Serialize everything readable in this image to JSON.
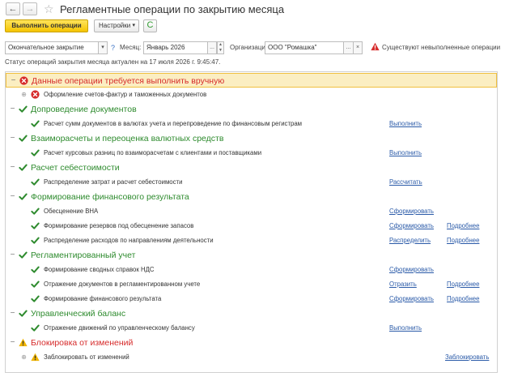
{
  "window": {
    "title": "Регламентные операции по закрытию месяца",
    "back_glyph": "←",
    "forward_glyph": "→",
    "favorite_glyph": "☆"
  },
  "toolbar": {
    "run_label": "Выполнить операции",
    "settings_label": "Настройки",
    "settings_caret": "▾",
    "refresh_glyph": "C"
  },
  "filters": {
    "closing_type": "Окончательное закрытие",
    "dropdown_glyph": "▾",
    "help_glyph": "?",
    "month_label": "Месяц:",
    "month_value": "Январь 2026",
    "picker_glyph": "...",
    "org_label": "Организации:",
    "org_value": "ООО \"Ромашка\"",
    "clear_glyph": "×",
    "warning_text": "Существуют невыполненные операции"
  },
  "status_text": "Статус операций закрытия месяца актуален на 17 июля 2026 г. 9:45:47.",
  "colors": {
    "success": "#2e8b2e",
    "error": "#d62b2b",
    "warning": "#f0b400",
    "link": "#2a5aa8",
    "highlight": "#fbeec2"
  },
  "groups": [
    {
      "title": "Данные операции требуется выполнить вручную",
      "status": "error",
      "items": [
        {
          "title": "Оформление счетов-фактур и таможенных документов",
          "status": "error",
          "expandable": true
        }
      ]
    },
    {
      "title": "Допроведение документов",
      "status": "ok",
      "items": [
        {
          "title": "Расчет сумм документов в валютах учета и перепроведение по финансовым регистрам",
          "status": "ok",
          "action": "Выполнить"
        }
      ]
    },
    {
      "title": "Взаиморасчеты и переоценка валютных средств",
      "status": "ok",
      "items": [
        {
          "title": "Расчет курсовых разниц по взаиморасчетам с клиентами и поставщиками",
          "status": "ok",
          "action": "Выполнить"
        }
      ]
    },
    {
      "title": "Расчет себестоимости",
      "status": "ok",
      "items": [
        {
          "title": "Распределение затрат и расчет себестоимости",
          "status": "ok",
          "action": "Рассчитать"
        }
      ]
    },
    {
      "title": "Формирование финансового результата",
      "status": "ok",
      "items": [
        {
          "title": "Обесценение ВНА",
          "status": "ok",
          "action": "Сформировать"
        },
        {
          "title": "Формирование резервов под обесценение запасов",
          "status": "ok",
          "action": "Сформировать",
          "details": "Подробнее"
        },
        {
          "title": "Распределение расходов по направлениям деятельности",
          "status": "ok",
          "action": "Распределить",
          "details": "Подробнее"
        }
      ]
    },
    {
      "title": "Регламентированный учет",
      "status": "ok",
      "items": [
        {
          "title": "Формирование сводных справок НДС",
          "status": "ok",
          "action": "Сформировать"
        },
        {
          "title": "Отражение документов в регламентированном учете",
          "status": "ok",
          "action": "Отразить",
          "details": "Подробнее"
        },
        {
          "title": "Формирование финансового результата",
          "status": "ok",
          "action": "Сформировать",
          "details": "Подробнее"
        }
      ]
    },
    {
      "title": "Управленческий баланс",
      "status": "ok",
      "items": [
        {
          "title": "Отражение движений по управленческому балансу",
          "status": "ok",
          "action": "Выполнить"
        }
      ]
    },
    {
      "title": "Блокировка от изменений",
      "status": "warning",
      "items": [
        {
          "title": "Заблокировать от изменений",
          "status": "warning",
          "expandable": true,
          "action_right": "Заблокировать"
        }
      ]
    }
  ]
}
